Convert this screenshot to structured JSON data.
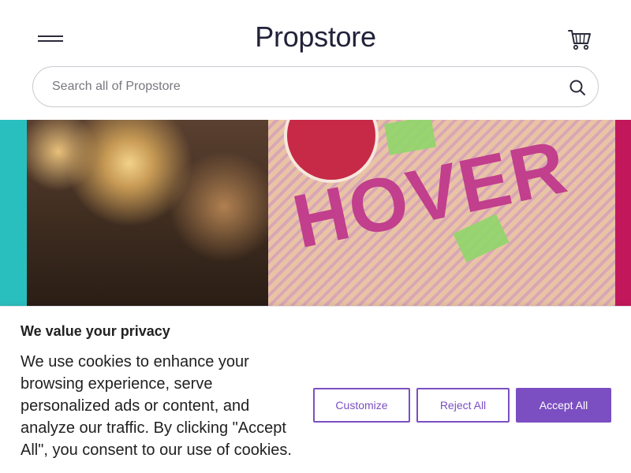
{
  "header": {
    "logo": "Propstore",
    "menu_icon": "hamburger-menu-icon",
    "cart_icon": "shopping-cart-icon"
  },
  "search": {
    "placeholder": "Search all of Propstore",
    "value": "",
    "icon": "search-icon"
  },
  "hero": {
    "image_text": "HOVER"
  },
  "cookie_banner": {
    "title": "We value your privacy",
    "body": "We use cookies to enhance your browsing experience, serve personalized ads or content, and analyze our traffic. By clicking \"Accept All\", you consent to our use of cookies.",
    "customize_label": "Customize",
    "reject_label": "Reject All",
    "accept_label": "Accept All"
  },
  "colors": {
    "accent": "#7b4fc1",
    "teal": "#2abfbf",
    "text": "#212121"
  }
}
